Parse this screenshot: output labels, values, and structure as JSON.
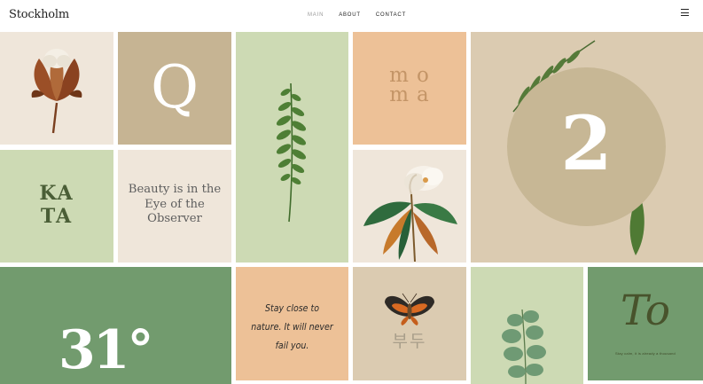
{
  "header": {
    "logo": "Stockholm",
    "nav": [
      "MAIN",
      "ABOUT",
      "CONTACT"
    ],
    "active_nav": "MAIN",
    "menu_icon": "hamburger-icon"
  },
  "tiles": {
    "q": "Q",
    "moma_line1": "mo",
    "moma_line2": "ma",
    "kata_line1": "KA",
    "kata_line2": "TA",
    "beauty": "Beauty is in the Eye of the Observer",
    "two": "2",
    "numbers": "31°",
    "quote": "Stay close to nature. It will never fail you.",
    "moth_caption": "부두",
    "to": "To",
    "to_sub": "Stay calm, it is already a thousand"
  },
  "colors": {
    "cream": "#efe6da",
    "tan": "#c6b493",
    "sage": "#cddab4",
    "peach": "#edc197",
    "beige": "#dbcbb1",
    "green": "#729b6e",
    "circle": "#c7b795"
  }
}
